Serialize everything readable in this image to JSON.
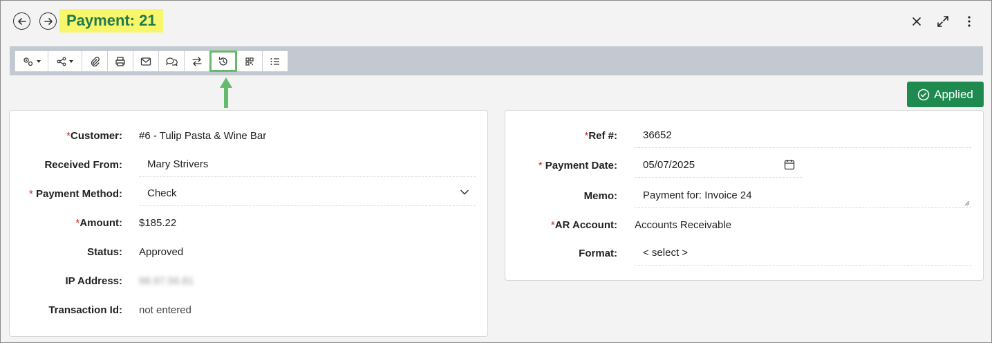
{
  "header": {
    "title": "Payment: 21",
    "back_icon": "arrow-left-icon",
    "forward_icon": "arrow-right-icon",
    "close_icon": "close-icon",
    "expand_icon": "expand-icon",
    "more_icon": "more-vertical-icon"
  },
  "toolbar": {
    "buttons": [
      "settings-icon",
      "share-icon",
      "paperclip-icon",
      "print-icon",
      "email-icon",
      "comments-icon",
      "transfer-icon",
      "history-icon",
      "qr-code-icon",
      "list-icon"
    ],
    "highlighted": "history-icon"
  },
  "status_button": {
    "label": "Applied",
    "color": "#1e8a4f"
  },
  "left_panel": {
    "customer": {
      "label": "Customer:",
      "value": "#6 - Tulip Pasta & Wine Bar"
    },
    "received_from": {
      "label": "Received From:",
      "value": "Mary Strivers"
    },
    "payment_method": {
      "label": "Payment Method:",
      "value": "Check"
    },
    "amount": {
      "label": "Amount:",
      "value": "$185.22"
    },
    "status": {
      "label": "Status:",
      "value": "Approved"
    },
    "ip_address": {
      "label": "IP Address:",
      "value": "98.97.56.81"
    },
    "transaction_id": {
      "label": "Transaction Id:",
      "value": "not entered"
    }
  },
  "right_panel": {
    "ref": {
      "label": "Ref #:",
      "value": "36652"
    },
    "payment_date": {
      "label": "Payment Date:",
      "value": "05/07/2025"
    },
    "memo": {
      "label": "Memo:",
      "value": "Payment for: Invoice 24"
    },
    "ar_account": {
      "label": "AR Account:",
      "value": "Accounts Receivable"
    },
    "format": {
      "label": "Format:",
      "value": "< select >"
    }
  },
  "colors": {
    "accent": "#1f7a4d",
    "highlight": "#f8f66a",
    "toolbar": "#c2c9d1",
    "arrow": "#66bb6a",
    "required": "#c62828"
  }
}
